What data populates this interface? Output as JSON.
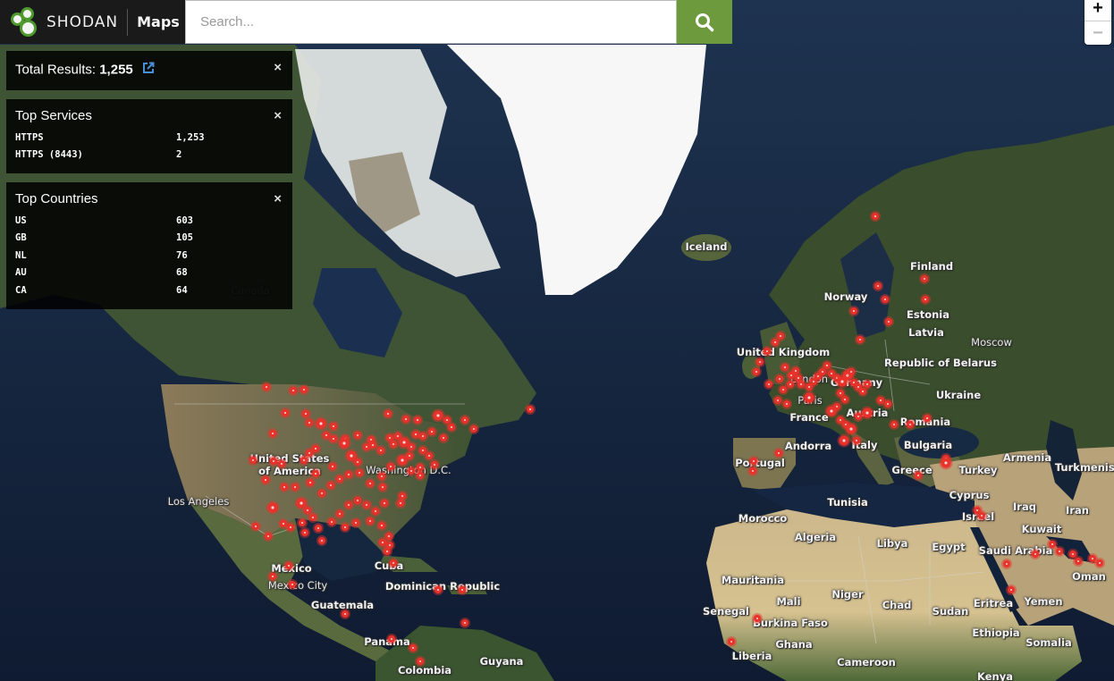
{
  "header": {
    "brand_name": "SHODAN",
    "product_name": "Maps",
    "search_placeholder": "Search...",
    "search_value": "",
    "search_icon": "search-icon",
    "accent_color": "#6c9a3c"
  },
  "zoom_controls": {
    "zoom_in_label": "+",
    "zoom_out_label": "−"
  },
  "panels": {
    "total": {
      "label": "Total Results:",
      "value": "1,255",
      "link_icon": "external-link-icon",
      "close_label": "×"
    },
    "services": {
      "title": "Top Services",
      "close_label": "×",
      "rows": [
        {
          "name": "HTTPS",
          "count": "1,253"
        },
        {
          "name": "HTTPS (8443)",
          "count": "2"
        }
      ]
    },
    "countries": {
      "title": "Top Countries",
      "close_label": "×",
      "rows": [
        {
          "name": "US",
          "count": "603"
        },
        {
          "name": "GB",
          "count": "105"
        },
        {
          "name": "NL",
          "count": "76"
        },
        {
          "name": "AU",
          "count": "68"
        },
        {
          "name": "CA",
          "count": "64"
        }
      ]
    }
  },
  "map": {
    "marker_color": "#e8322b",
    "labels": [
      {
        "text": "Canada",
        "kind": "muted"
      },
      {
        "text": "Iceland",
        "kind": "country"
      },
      {
        "text": "Finland",
        "kind": "country"
      },
      {
        "text": "Norway",
        "kind": "country"
      },
      {
        "text": "Estonia",
        "kind": "country"
      },
      {
        "text": "Latvia",
        "kind": "country"
      },
      {
        "text": "Moscow",
        "kind": "city"
      },
      {
        "text": "United Kingdom",
        "kind": "country"
      },
      {
        "text": "Republic of Belarus",
        "kind": "country"
      },
      {
        "text": "London",
        "kind": "city"
      },
      {
        "text": "Germany",
        "kind": "country"
      },
      {
        "text": "Paris",
        "kind": "city"
      },
      {
        "text": "Ukraine",
        "kind": "country"
      },
      {
        "text": "France",
        "kind": "country"
      },
      {
        "text": "Austria",
        "kind": "country"
      },
      {
        "text": "Romania",
        "kind": "country"
      },
      {
        "text": "Andorra",
        "kind": "country"
      },
      {
        "text": "Italy",
        "kind": "country"
      },
      {
        "text": "Bulgaria",
        "kind": "country"
      },
      {
        "text": "Armenia",
        "kind": "country"
      },
      {
        "text": "Portugal",
        "kind": "country"
      },
      {
        "text": "Greece",
        "kind": "country"
      },
      {
        "text": "Turkey",
        "kind": "country"
      },
      {
        "text": "Turkmenistan",
        "kind": "country"
      },
      {
        "text": "Cyprus",
        "kind": "country"
      },
      {
        "text": "Tunisia",
        "kind": "country"
      },
      {
        "text": "Iraq",
        "kind": "country"
      },
      {
        "text": "Iran",
        "kind": "country"
      },
      {
        "text": "Israel",
        "kind": "country"
      },
      {
        "text": "Morocco",
        "kind": "country"
      },
      {
        "text": "Kuwait",
        "kind": "country"
      },
      {
        "text": "Algeria",
        "kind": "country"
      },
      {
        "text": "Libya",
        "kind": "country"
      },
      {
        "text": "Egypt",
        "kind": "country"
      },
      {
        "text": "Saudi Arabia",
        "kind": "country"
      },
      {
        "text": "Oman",
        "kind": "country"
      },
      {
        "text": "Mauritania",
        "kind": "country"
      },
      {
        "text": "Mali",
        "kind": "country"
      },
      {
        "text": "Niger",
        "kind": "country"
      },
      {
        "text": "Chad",
        "kind": "country"
      },
      {
        "text": "Sudan",
        "kind": "country"
      },
      {
        "text": "Eritrea",
        "kind": "country"
      },
      {
        "text": "Yemen",
        "kind": "country"
      },
      {
        "text": "Senegal",
        "kind": "country"
      },
      {
        "text": "Burkina Faso",
        "kind": "country"
      },
      {
        "text": "Ethiopia",
        "kind": "country"
      },
      {
        "text": "Ghana",
        "kind": "country"
      },
      {
        "text": "Somalia",
        "kind": "country"
      },
      {
        "text": "Liberia",
        "kind": "country"
      },
      {
        "text": "Cameroon",
        "kind": "country"
      },
      {
        "text": "Kenya",
        "kind": "country"
      },
      {
        "text": "United States",
        "kind": "country"
      },
      {
        "text": "of America",
        "kind": "country"
      },
      {
        "text": "Washington D.C.",
        "kind": "city"
      },
      {
        "text": "Los Angeles",
        "kind": "city"
      },
      {
        "text": "Mexico",
        "kind": "country"
      },
      {
        "text": "Mexico City",
        "kind": "city"
      },
      {
        "text": "Cuba",
        "kind": "country"
      },
      {
        "text": "Dominican Republic",
        "kind": "country"
      },
      {
        "text": "Guatemala",
        "kind": "country"
      },
      {
        "text": "Panama",
        "kind": "country"
      },
      {
        "text": "Guyana",
        "kind": "country"
      },
      {
        "text": "Colombia",
        "kind": "country"
      }
    ]
  }
}
